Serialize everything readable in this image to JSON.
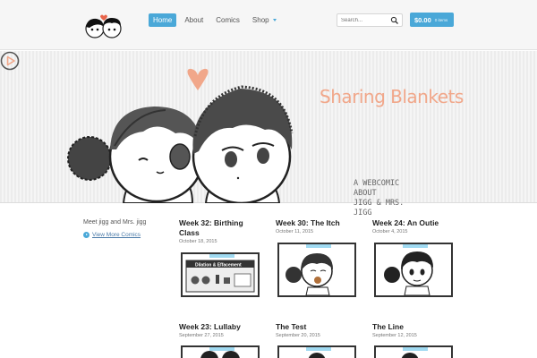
{
  "nav": {
    "items": [
      {
        "label": "Home",
        "active": true
      },
      {
        "label": "About",
        "active": false
      },
      {
        "label": "Comics",
        "active": false
      },
      {
        "label": "Shop",
        "active": false
      }
    ]
  },
  "search": {
    "placeholder": "Search..."
  },
  "cart": {
    "total": "$0.00",
    "items": "0 items"
  },
  "hero": {
    "title": "Sharing Blankets",
    "tagline_lines": [
      "A WEBCOMIC ABOUT",
      "JIGG & MRS. JIGG"
    ]
  },
  "sidebar": {
    "text": "Meet jigg and Mrs. jigg",
    "view_more": "View More Comics"
  },
  "comics": [
    {
      "title": "Week 32: Birthing Class",
      "date": "October 18, 2015",
      "thumb_text": "Dilation & Effacement"
    },
    {
      "title": "Week 30: The Itch",
      "date": "October 11, 2015"
    },
    {
      "title": "Week 24: An Outie",
      "date": "October 4, 2015"
    },
    {
      "title": "Week 23: Lullaby",
      "date": "September 27, 2015"
    },
    {
      "title": "The Test",
      "date": "September 20, 2015"
    },
    {
      "title": "The Line",
      "date": "September 12, 2015"
    }
  ],
  "colors": {
    "accent": "#4aa8d8",
    "hero_title": "#f1a78a"
  }
}
